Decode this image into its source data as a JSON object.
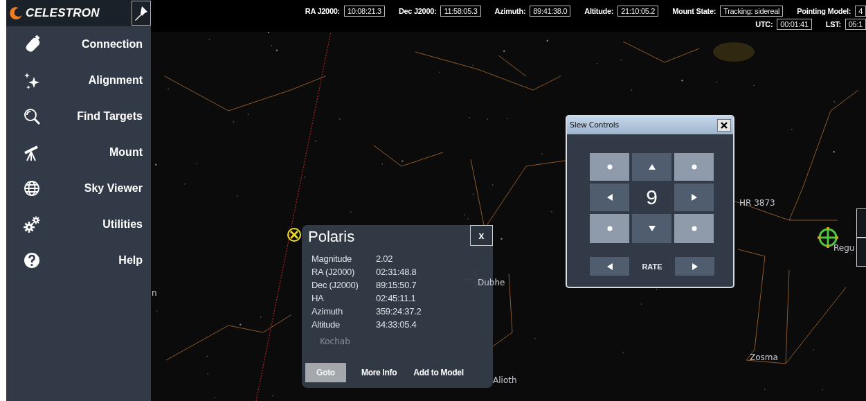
{
  "sidebar": {
    "logo": "CELESTRON",
    "items": [
      {
        "label": "Connection"
      },
      {
        "label": "Alignment"
      },
      {
        "label": "Find Targets"
      },
      {
        "label": "Mount"
      },
      {
        "label": "Sky Viewer"
      },
      {
        "label": "Utilities"
      },
      {
        "label": "Help"
      }
    ]
  },
  "status_bar": {
    "fields": [
      {
        "label": "RA J2000:",
        "value": "10:08:21.3"
      },
      {
        "label": "Dec J2000:",
        "value": "11:58:05.3"
      },
      {
        "label": "Azimuth:",
        "value": "89:41:38.0"
      },
      {
        "label": "Altitude:",
        "value": "21:10:05.2"
      },
      {
        "label": "Mount State:",
        "value": "Tracking: sidereal"
      },
      {
        "label": "Pointing Model:",
        "value": "4"
      }
    ],
    "time_fields": [
      {
        "label": "UTC:",
        "value": "00:01:41"
      },
      {
        "label": "LST:",
        "value": "05:1"
      }
    ]
  },
  "sky": {
    "labels": [
      "n",
      "Kochab",
      "Dubhe",
      "Alioth",
      "HR 3873",
      "Regu",
      "Zosma"
    ]
  },
  "star_popup": {
    "title": "Polaris",
    "close": "x",
    "rows": [
      {
        "label": "Magnitude",
        "value": "2.02"
      },
      {
        "label": "RA (J2000)",
        "value": "02:31:48.8"
      },
      {
        "label": "Dec (J2000)",
        "value": "89:15:50.7"
      },
      {
        "label": "HA",
        "value": "02:45:11.1"
      },
      {
        "label": "Azimuth",
        "value": "359:24:37.2"
      },
      {
        "label": "Altitude",
        "value": "34:33:05.4"
      }
    ],
    "buttons": [
      {
        "label": "Goto",
        "disabled": true
      },
      {
        "label": "More Info",
        "disabled": false
      },
      {
        "label": "Add to Model",
        "disabled": false
      }
    ]
  },
  "slew_controls": {
    "title": "Slew Controls",
    "rate": "9",
    "rate_label": "RATE"
  }
}
